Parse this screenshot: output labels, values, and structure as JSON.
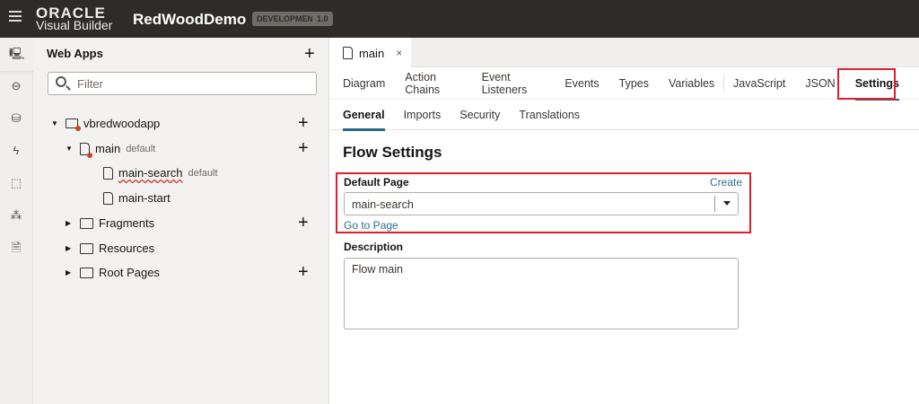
{
  "header": {
    "logo_top": "ORACLE",
    "logo_bottom": "Visual Builder",
    "app_name": "RedWoodDemo",
    "env_badge": "DEVELOPMENT",
    "version_badge": "1.0"
  },
  "nav": {
    "title": "Web Apps",
    "filter_placeholder": "Filter",
    "tree": [
      {
        "label": "vbredwoodapp",
        "suffix": ""
      },
      {
        "label": "main",
        "suffix": "default"
      },
      {
        "label": "main-search",
        "suffix": "default"
      },
      {
        "label": "main-start",
        "suffix": ""
      },
      {
        "label": "Fragments",
        "suffix": ""
      },
      {
        "label": "Resources",
        "suffix": ""
      },
      {
        "label": "Root Pages",
        "suffix": ""
      }
    ]
  },
  "editor": {
    "file_tab": "main",
    "tabs": [
      "Diagram",
      "Action Chains",
      "Event Listeners",
      "Events",
      "Types",
      "Variables",
      "JavaScript",
      "JSON",
      "Settings"
    ],
    "subtabs": [
      "General",
      "Imports",
      "Security",
      "Translations"
    ],
    "heading": "Flow Settings",
    "default_page_label": "Default Page",
    "create_link": "Create",
    "default_page_value": "main-search",
    "go_to_page": "Go to Page",
    "description_label": "Description",
    "description_value": "Flow main"
  },
  "colors": {
    "header": "#2f2b28",
    "accent": "#2b6a86",
    "highlight": "#e21d2c"
  }
}
